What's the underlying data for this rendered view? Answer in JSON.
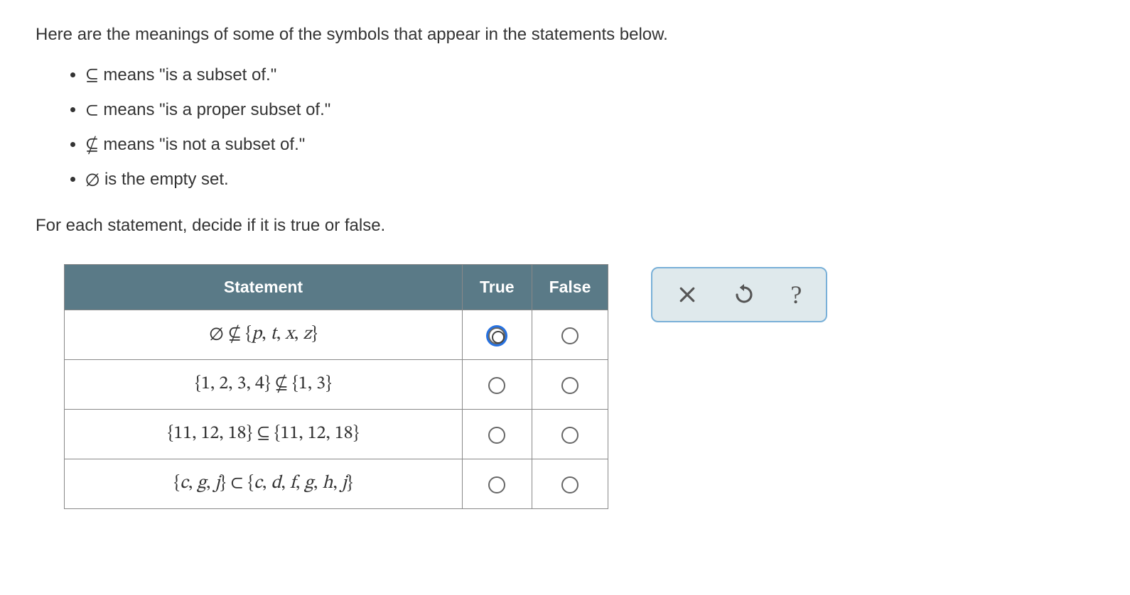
{
  "intro": "Here are the meanings of some of the symbols that appear in the statements below.",
  "defs": [
    {
      "symbol": "⊆",
      "meaning": " means \"is a subset of.\""
    },
    {
      "symbol": "⊂",
      "meaning": " means \"is a proper subset of.\""
    },
    {
      "symbol": "⊈",
      "meaning": " means \"is not a subset of.\""
    },
    {
      "symbol": "∅",
      "meaning": " is the empty set."
    }
  ],
  "instruction": "For each statement, decide if it is true or false.",
  "headers": {
    "statement": "Statement",
    "true": "True",
    "false": "False"
  },
  "rows": [
    {
      "statement_html": "∅ ⊈ {<i>p</i>, <i>t</i>, <i>x</i>, <i>z</i>}",
      "true_focused": true
    },
    {
      "statement_html": "{1, 2, 3, 4} ⊈ {1, 3}",
      "true_focused": false
    },
    {
      "statement_html": "{11, 12, 18} ⊆ {11, 12, 18}",
      "true_focused": false
    },
    {
      "statement_html": "{<i>c</i>, <i>g</i>, <i>j</i>} ⊂ {<i>c</i>, <i>d</i>, <i>f</i>, <i>g</i>, <i>h</i>, <i>j</i>}",
      "true_focused": false
    }
  ],
  "toolbar": {
    "close": "close",
    "undo": "undo",
    "help": "?"
  }
}
